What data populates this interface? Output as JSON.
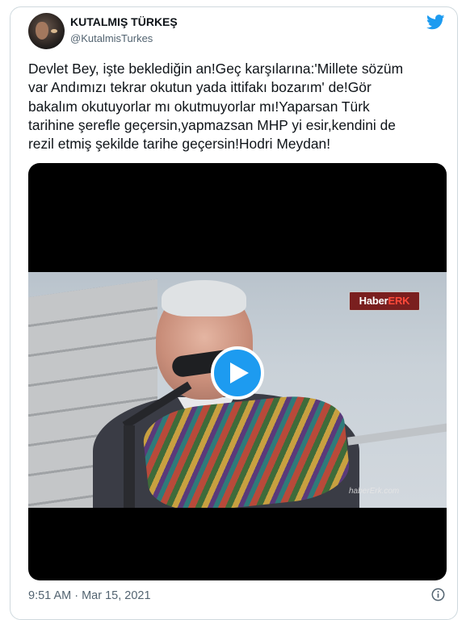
{
  "author": {
    "name": "KUTALMIŞ TÜRKEŞ",
    "handle": "@KutalmisTurkes"
  },
  "tweet": {
    "lines": [
      "Devlet Bey, işte beklediğin an!Geç karşılarına:'Millete sözüm",
      "var Andımızı tekrar okutun yada ittifakı bozarım' de!Gör",
      "bakalım okutuyorlar mı okutmuyorlar mı!Yaparsan Türk",
      "tarihine şerefle geçersin,yapmazsan MHP yi esir,kendini de",
      "rezil etmiş şekilde tarihe geçersin!Hodri Meydan!"
    ]
  },
  "video": {
    "logo_prefix": "Haber",
    "logo_suffix": "ERK",
    "watermark": "haberErk.com"
  },
  "footer": {
    "timestamp": "9:51 AM · Mar 15, 2021"
  },
  "icons": {
    "brand": "twitter-bird-icon",
    "play": "play-icon",
    "info": "info-icon"
  },
  "colors": {
    "accent": "#1d9bf0",
    "text": "#0f1419",
    "muted": "#536471",
    "border": "#cfd9de"
  }
}
